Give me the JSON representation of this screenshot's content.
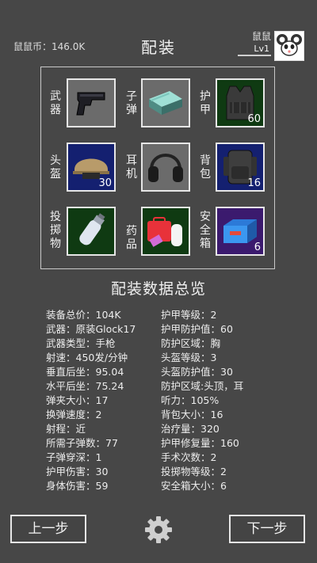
{
  "header": {
    "currency": "鼠鼠币：146.0K",
    "title": "配装",
    "username": "鼠鼠",
    "level": "Lv1"
  },
  "slots": [
    {
      "label": "武器",
      "count": ""
    },
    {
      "label": "子弹",
      "count": ""
    },
    {
      "label": "护甲",
      "count": "60"
    },
    {
      "label": "头盔",
      "count": "30"
    },
    {
      "label": "耳机",
      "count": ""
    },
    {
      "label": "背包",
      "count": "16"
    },
    {
      "label": "投掷物",
      "count": ""
    },
    {
      "label": "药品",
      "count": ""
    },
    {
      "label": "安全箱",
      "count": "6"
    }
  ],
  "stats_title": "配装数据总览",
  "stats_left": [
    "装备总价：104K",
    "武器：原装Glock17",
    "武器类型：手枪",
    "射速：450发/分钟",
    "垂直后坐：95.04",
    "水平后坐：75.24",
    "弹夹大小：17",
    "换弹速度：2",
    "射程：近",
    "所需子弹数：77",
    "子弹穿深：1",
    "护甲伤害：30",
    "身体伤害：59"
  ],
  "stats_right": [
    "护甲等级：2",
    "护甲防护值：60",
    "防护区域：胸",
    "头盔等级：3",
    "头盔防护值：30",
    "防护区域:头顶，耳",
    "听力：105%",
    "背包大小：16",
    "治疗量：320",
    "护甲修复量：160",
    "手术次数：2",
    "投掷物等级：2",
    "安全箱大小：6"
  ],
  "buttons": {
    "prev": "上一步",
    "next": "下一步"
  },
  "colors": {
    "background": "#474747",
    "slot_gray": "#6b6b6b",
    "slot_green": "#0f3a12",
    "slot_blue": "#142070",
    "slot_purple": "#3b1a6e"
  }
}
